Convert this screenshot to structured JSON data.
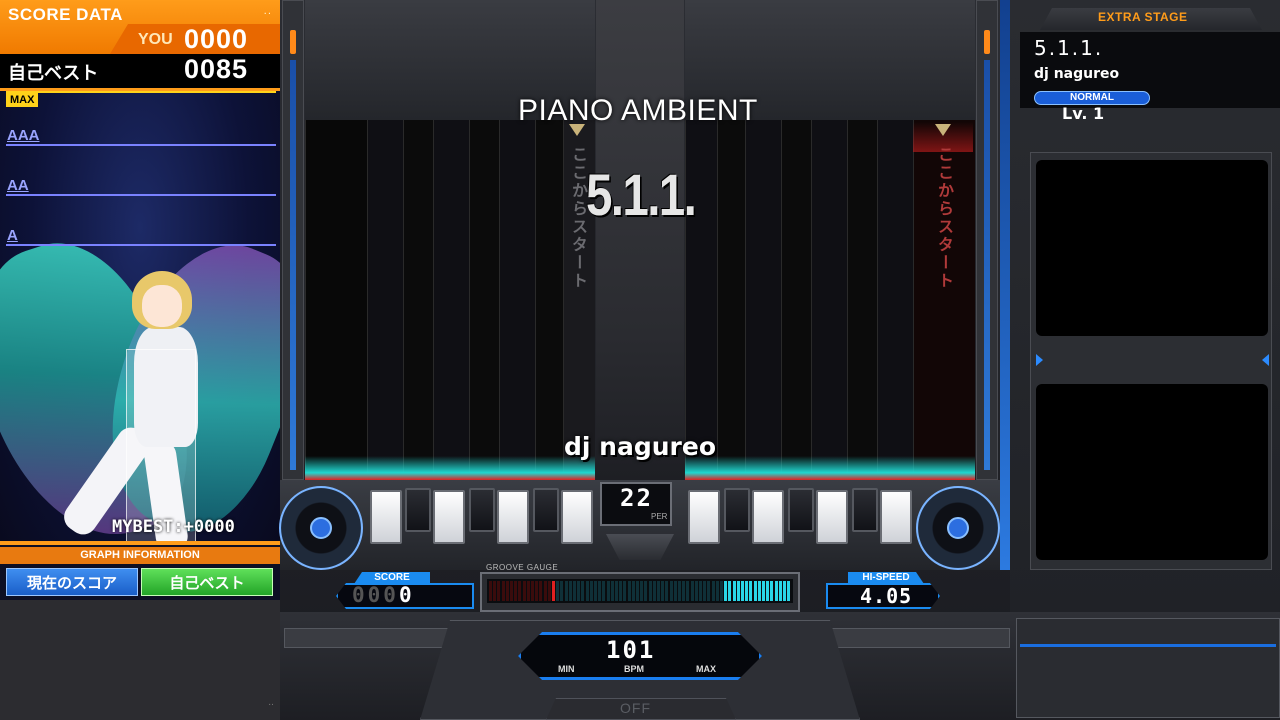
{
  "score_data": {
    "title": "SCORE DATA",
    "dots": "..",
    "you_label": "YOU",
    "you_score": "0000",
    "best_label": "自己ベスト",
    "best_score": "0085"
  },
  "graph": {
    "max_label": "MAX",
    "ranks": [
      "AAA",
      "AA",
      "A"
    ],
    "mybest": "MYBEST:+0000",
    "info_label": "GRAPH INFORMATION",
    "btn_current": "現在のスコア",
    "btn_best": "自己ベスト"
  },
  "song": {
    "genre": "PIANO AMBIENT",
    "title_big": "5.1.1.",
    "artist": "dj nagureo",
    "start_hint": "ここからスタート"
  },
  "play": {
    "per_value": "22",
    "per_label": "PER",
    "score_label": "SCORE",
    "score_value_dim": "000",
    "score_value_lit": "0",
    "gauge_label": "GROOVE GAUGE",
    "gauge_percent": 22,
    "hispeed_label": "HI-SPEED",
    "hispeed_value": "4.05",
    "bpm_value": "101",
    "bpm_min": "MIN",
    "bpm_label": "BPM",
    "bpm_max": "MAX",
    "off_label": "OFF"
  },
  "stage": {
    "stage_label": "EXTRA STAGE",
    "title": "5.1.1.",
    "artist": "dj nagureo",
    "difficulty": "NORMAL",
    "level": "Lv. 1"
  },
  "colors": {
    "accent_orange": "#ff9c1a",
    "accent_blue": "#1a8bf0",
    "gauge_cyan": "#2ad6e6",
    "judge_red": "#e02020"
  }
}
